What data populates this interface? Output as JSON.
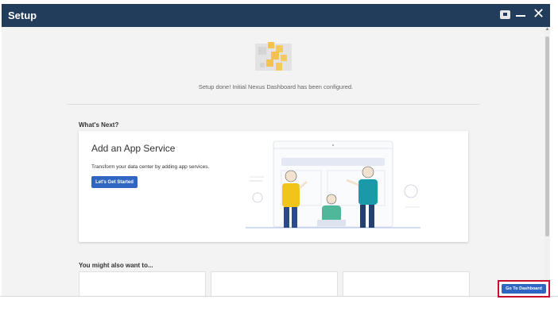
{
  "window": {
    "title": "Setup"
  },
  "main": {
    "setup_message": "Setup done! Initial Nexus Dashboard has been configured.",
    "whats_next_label": "What's Next?",
    "card": {
      "title": "Add an App Service",
      "description": "Transform your data center by adding app services.",
      "button_label": "Let's Get Started"
    },
    "also_label": "You might also want to..."
  },
  "footer": {
    "go_to_dashboard_label": "Go To Dashboard"
  },
  "colors": {
    "titlebar": "#223c5c",
    "primary_button": "#2f66c2",
    "highlight_border": "#c8102e"
  }
}
